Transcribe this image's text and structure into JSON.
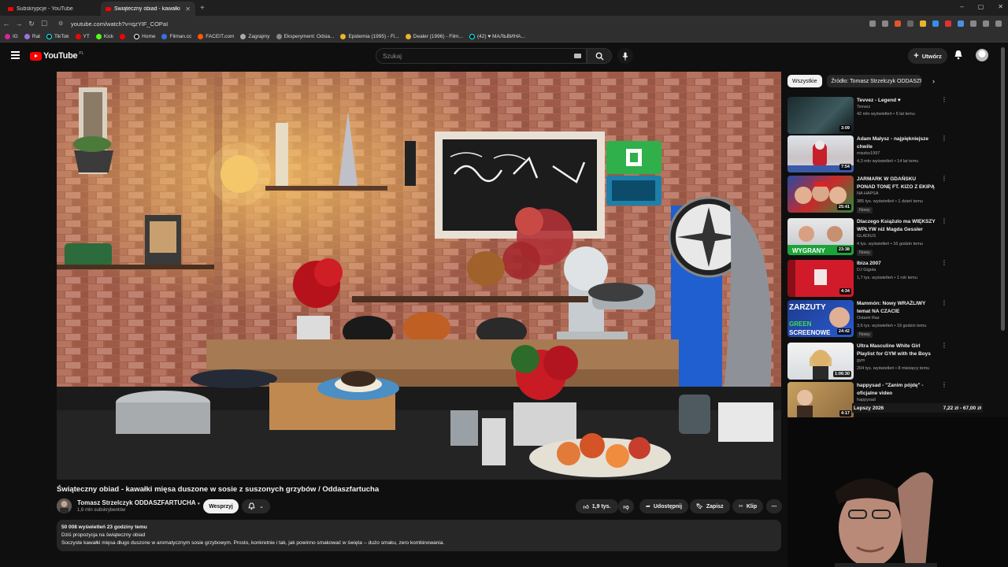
{
  "browser": {
    "tabs": [
      {
        "label": "Subskrypcje - YouTube",
        "active": false
      },
      {
        "label": "Świąteczny obiad - kawałki m",
        "active": true
      }
    ],
    "url": "youtube.com/watch?v=qzYIF_COPaI",
    "bookmarks": [
      "IG",
      "Rat",
      "TikTok",
      "YT",
      "Kick",
      "",
      "Home",
      "Filman.cc",
      "FACEIT.com",
      "Zagrajmy",
      "Eksperyment: Odsia...",
      "Epidemia (1995) - Fi...",
      "Dealer (1996) - Film...",
      "(42) ♥ МАЛЬВИНА..."
    ]
  },
  "header": {
    "logo": "YouTube",
    "country": "PL",
    "search_placeholder": "Szukaj",
    "create_label": "Utwórz"
  },
  "video": {
    "title": "Świąteczny obiad - kawałki mięsa duszone w sosie z suszonych grzybów / Oddaszfartucha",
    "channel": "Tomasz Strzelczyk ODDASZFARTUCHA",
    "subscribers": "1,6 mln subskrybentów",
    "support_label": "Wesprzyj",
    "likes": "1,9 tys.",
    "share_label": "Udostępnij",
    "save_label": "Zapisz",
    "clip_label": "Klip",
    "description": {
      "meta": "50 008 wyświetleń  23 godziny temu",
      "line1": "Dziś propozycja na świąteczny obiad",
      "line2": "Soczyste kawałki mięsa długo duszone w aromatycznym sosie grzybowym. Prosto, konkretnie i tak, jak powinno smakować w święta -- dużo smaku, zero kombinowania."
    }
  },
  "sidebar": {
    "chips": [
      {
        "label": "Wszystkie",
        "active": true
      },
      {
        "label": "Źródło: Tomasz Strzelczyk ODDASZFARTUCHA",
        "active": false
      }
    ],
    "recommendations": [
      {
        "title": "Tevvez - Legend ♥",
        "channel": "Tevvez",
        "stats": "42 mln wyświetleń • 5 lat temu",
        "duration": "3:09",
        "badge": ""
      },
      {
        "title": "Adam Małysz - najpiękniejsze chwile",
        "channel": "miszko1997",
        "stats": "4,3 mln wyświetleń • 14 lat temu",
        "duration": "7:54",
        "badge": ""
      },
      {
        "title": "JARMARK W GDAŃSKU PONAD TONĘ FT. KIZO Z EKIPĄ MTS",
        "channel": "NA HAPSA",
        "stats": "385 tys. wyświetleń • 1 dzień temu",
        "duration": "25:41",
        "badge": "Nowy"
      },
      {
        "title": "Dlaczego Książulo ma WIĘKSZY WPŁYW niż Magda Gessler",
        "channel": "GLADIUS",
        "stats": "4 tys. wyświetleń • 16 godzin temu",
        "duration": "23:38",
        "badge": "Nowy"
      },
      {
        "title": "Ibiza 2007",
        "channel": "DJ Gigola",
        "stats": "1,7 tys. wyświetleń • 1 rok temu",
        "duration": "4:34",
        "badge": ""
      },
      {
        "title": "Mammón: Nowy WRAŻLIWY temat NA CZACIE",
        "channel": "Ostami Raz",
        "stats": "3,6 tys. wyświetleń • 19 godzin temu",
        "duration": "24:42",
        "badge": "Nowy"
      },
      {
        "title": "Ultra Masculine White Girl Playlist for GYM with the Boys",
        "channel": "gym",
        "stats": "204 tys. wyświetleń • 8 miesięcy temu",
        "duration": "1:06:30",
        "badge": ""
      },
      {
        "title": "happysad - \"Zanim pójdę\" - oficjalne video",
        "channel": "happysad",
        "stats": "",
        "duration": "4:17",
        "badge": ""
      }
    ],
    "shop_overlay": {
      "label": "Lepszy 2026",
      "price": "7,22 zł - 67,00 zł"
    }
  }
}
